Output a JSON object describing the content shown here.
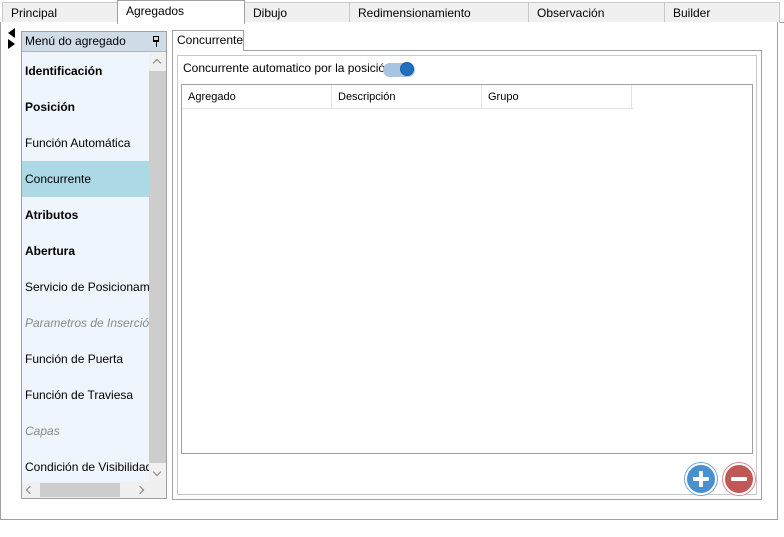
{
  "tabs": [
    {
      "label": "Principal",
      "active": false
    },
    {
      "label": "Agregados",
      "active": true
    },
    {
      "label": "Dibujo",
      "active": false
    },
    {
      "label": "Redimensionamiento",
      "active": false
    },
    {
      "label": "Observación",
      "active": false
    },
    {
      "label": "Builder",
      "active": false
    }
  ],
  "side_menu": {
    "title": "Menú do agregado",
    "items": [
      {
        "label": "Identificación",
        "style": "bold"
      },
      {
        "label": "Posición",
        "style": "bold"
      },
      {
        "label": "Función Automática",
        "style": "normal"
      },
      {
        "label": "Concurrente",
        "style": "selected"
      },
      {
        "label": "Atributos",
        "style": "bold"
      },
      {
        "label": "Abertura",
        "style": "bold"
      },
      {
        "label": "Servicio de Posicionamiento",
        "style": "normal"
      },
      {
        "label": "Parametros de Inserción",
        "style": "disabled"
      },
      {
        "label": "Función de Puerta",
        "style": "normal"
      },
      {
        "label": "Función de Traviesa",
        "style": "normal"
      },
      {
        "label": "Capas",
        "style": "disabled"
      },
      {
        "label": "Condición de Visibilidad",
        "style": "normal"
      }
    ]
  },
  "content": {
    "subtab_label": "Concurrente",
    "toggle_label": "Concurrente automatico por la posición",
    "toggle_on": true,
    "grid_columns": [
      "Agregado",
      "Descripción",
      "Grupo"
    ],
    "grid_rows": []
  },
  "colors": {
    "selected_item": "#add8e6",
    "toggle_track": "#a8c4e0",
    "toggle_knob": "#1f6fbf",
    "add_button": "#4a90cf",
    "remove_button": "#c05858"
  }
}
